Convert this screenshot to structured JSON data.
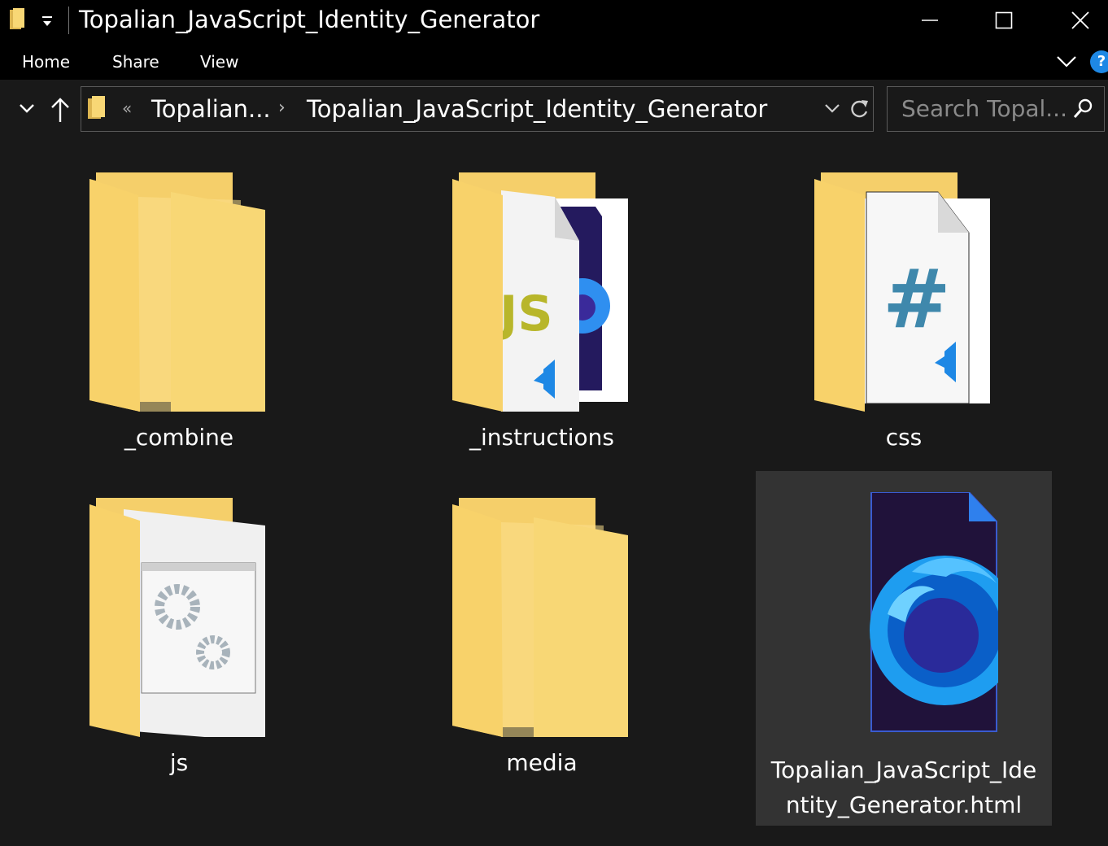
{
  "window": {
    "title": "Topalian_JavaScript_Identity_Generator",
    "quick_access": {
      "folder_icon": "folder-icon",
      "customize_icon": "dropdown-arrow-icon"
    },
    "controls": {
      "minimize_icon": "minimize-icon",
      "maximize_icon": "maximize-icon",
      "close_icon": "close-icon"
    }
  },
  "ribbon": {
    "tabs": [
      {
        "label": "Home"
      },
      {
        "label": "Share"
      },
      {
        "label": "View"
      }
    ],
    "expand_icon": "chevron-down-icon",
    "help_label": "?"
  },
  "navigation": {
    "recent_icon": "chevron-down-icon",
    "up_icon": "up-arrow-icon",
    "address": {
      "overflow": "«",
      "parts": [
        "Topalian...",
        "Topalian_JavaScript_Identity_Generator"
      ],
      "separator": "›"
    },
    "refresh_icon": "refresh-icon",
    "search": {
      "placeholder": "Search Topal...",
      "icon": "search-icon"
    }
  },
  "items": [
    {
      "name": "_combine",
      "type": "folder",
      "preview": "document-with-image"
    },
    {
      "name": "_instructions",
      "type": "folder",
      "preview": "js-and-browser-files"
    },
    {
      "name": "css",
      "type": "folder",
      "preview": "css-file"
    },
    {
      "name": "js",
      "type": "folder",
      "preview": "settings-gears"
    },
    {
      "name": "media",
      "type": "folder",
      "preview": "document-with-image"
    },
    {
      "name": "Topalian_JavaScript_Identity_Generator.html",
      "type": "html-file",
      "preview": "firefox-developer-edition",
      "selected": true
    }
  ],
  "colors": {
    "window_bg": "#191919",
    "titlebar_bg": "#000000",
    "selection_bg": "#333333",
    "folder_yellow": "#f8d775",
    "accent_blue": "#1e88e5"
  }
}
